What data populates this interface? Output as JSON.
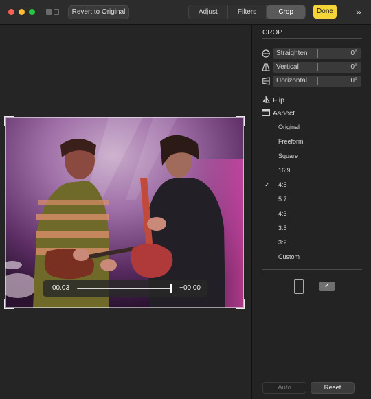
{
  "toolbar": {
    "revert_label": "Revert to Original",
    "tabs": [
      {
        "label": "Adjust",
        "active": false
      },
      {
        "label": "Filters",
        "active": false
      },
      {
        "label": "Crop",
        "active": true
      }
    ],
    "done_label": "Done",
    "accent_color": "#f5d43a"
  },
  "photo_overlay": {
    "left_value": "00.03",
    "right_value": "−00.00"
  },
  "panel": {
    "crop_header": "CROP",
    "sliders": [
      {
        "label": "Straighten",
        "value": "0°",
        "icon": "straighten-icon"
      },
      {
        "label": "Vertical",
        "value": "0°",
        "icon": "vertical-perspective-icon"
      },
      {
        "label": "Horizontal",
        "value": "0°",
        "icon": "horizontal-perspective-icon"
      }
    ],
    "flip_label": "Flip",
    "aspect_label": "Aspect",
    "aspect_options": [
      "Original",
      "Freeform",
      "Square",
      "16:9",
      "4:5",
      "5:7",
      "4:3",
      "3:5",
      "3:2",
      "Custom"
    ],
    "aspect_selected": "4:5",
    "check_glyph": "✓",
    "landscape_glyph": "✓",
    "auto_label": "Auto",
    "reset_label": "Reset"
  }
}
